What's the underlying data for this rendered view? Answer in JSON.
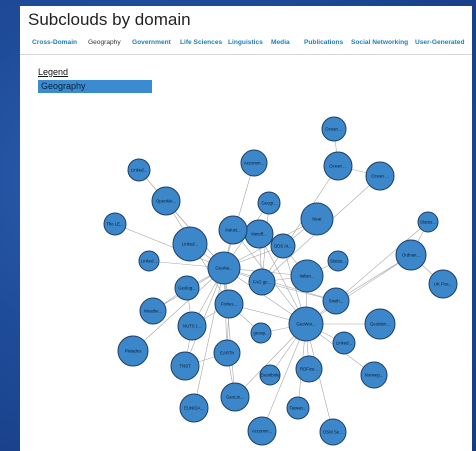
{
  "title": "Subclouds by domain",
  "tabs": [
    {
      "label": "Cross-Domain"
    },
    {
      "label": "Geography",
      "active": true
    },
    {
      "label": "Government"
    },
    {
      "label": "Life Sciences"
    },
    {
      "label": "Linguistics"
    },
    {
      "label": "Media"
    },
    {
      "label": "Publications"
    },
    {
      "label": "Social Networking"
    },
    {
      "label": "User-Generated"
    }
  ],
  "legend": {
    "title": "Legend",
    "items": [
      {
        "label": "Geography",
        "color": "#3b8bd0"
      }
    ]
  },
  "graph": {
    "node_color": "#3c87c9",
    "nodes": [
      {
        "id": "n01",
        "label": "Ocean ..."
      },
      {
        "id": "n02",
        "label": "Accomm..."
      },
      {
        "id": "n03",
        "label": "Ocean ..."
      },
      {
        "id": "n04",
        "label": "Linked..."
      },
      {
        "id": "n05",
        "label": "Ocean ..."
      },
      {
        "id": "n06",
        "label": "OpenMo..."
      },
      {
        "id": "n07",
        "label": "Geogr..."
      },
      {
        "id": "n08",
        "label": "Near"
      },
      {
        "id": "n09",
        "label": "Metoff..."
      },
      {
        "id": "n10",
        "label": "The LE..."
      },
      {
        "id": "n11",
        "label": "Linked..."
      },
      {
        "id": "n12",
        "label": "Indust..."
      },
      {
        "id": "n13",
        "label": "DDS At..."
      },
      {
        "id": "n14",
        "label": "Ordnan..."
      },
      {
        "id": "n15",
        "label": "Linked..."
      },
      {
        "id": "n16",
        "label": "GeoNa..."
      },
      {
        "id": "n17",
        "label": "Status..."
      },
      {
        "id": "n18",
        "label": "UK Pos..."
      },
      {
        "id": "n19",
        "label": "Geolog..."
      },
      {
        "id": "n20",
        "label": "FAO ge..."
      },
      {
        "id": "n21",
        "label": "Italian..."
      },
      {
        "id": "n22",
        "label": "Status..."
      },
      {
        "id": "n23",
        "label": "Fishes..."
      },
      {
        "id": "n24",
        "label": "Weathe..."
      },
      {
        "id": "n25",
        "label": "Smith..."
      },
      {
        "id": "n26",
        "label": "NUTS (..."
      },
      {
        "id": "n27",
        "label": "GeoWor..."
      },
      {
        "id": "n28",
        "label": "GeoMon..."
      },
      {
        "id": "n29",
        "label": "geosp..."
      },
      {
        "id": "n30",
        "label": "Linked..."
      },
      {
        "id": "n31",
        "label": "Pleiades"
      },
      {
        "id": "n32",
        "label": "EARTh"
      },
      {
        "id": "n33",
        "label": "TNST"
      },
      {
        "id": "n34",
        "label": "Eventbrite"
      },
      {
        "id": "n35",
        "label": "RDFize..."
      },
      {
        "id": "n36",
        "label": "Norweg..."
      },
      {
        "id": "n37",
        "label": "GeoLin..."
      },
      {
        "id": "n38",
        "label": "EUNIDA..."
      },
      {
        "id": "n39",
        "label": "Taiwan..."
      },
      {
        "id": "n40",
        "label": "Accomm..."
      },
      {
        "id": "n41",
        "label": "OSM Se..."
      }
    ],
    "edges": [
      [
        "n01",
        "n03"
      ],
      [
        "n03",
        "n05"
      ],
      [
        "n03",
        "n20"
      ],
      [
        "n02",
        "n16"
      ],
      [
        "n04",
        "n16"
      ],
      [
        "n06",
        "n16"
      ],
      [
        "n06",
        "n23"
      ],
      [
        "n10",
        "n16"
      ],
      [
        "n11",
        "n16"
      ],
      [
        "n12",
        "n16"
      ],
      [
        "n07",
        "n16"
      ],
      [
        "n07",
        "n20"
      ],
      [
        "n13",
        "n16"
      ],
      [
        "n08",
        "n16"
      ],
      [
        "n08",
        "n13"
      ],
      [
        "n15",
        "n16"
      ],
      [
        "n19",
        "n16"
      ],
      [
        "n24",
        "n16"
      ],
      [
        "n26",
        "n16"
      ],
      [
        "n31",
        "n16"
      ],
      [
        "n33",
        "n16"
      ],
      [
        "n38",
        "n16"
      ],
      [
        "n32",
        "n16"
      ],
      [
        "n23",
        "n16"
      ],
      [
        "n20",
        "n16"
      ],
      [
        "n21",
        "n16"
      ],
      [
        "n27",
        "n16"
      ],
      [
        "n37",
        "n16"
      ],
      [
        "n05",
        "n20"
      ],
      [
        "n13",
        "n21"
      ],
      [
        "n20",
        "n21"
      ],
      [
        "n22",
        "n21"
      ],
      [
        "n21",
        "n27"
      ],
      [
        "n14",
        "n27"
      ],
      [
        "n14",
        "n17"
      ],
      [
        "n14",
        "n25"
      ],
      [
        "n14",
        "n18"
      ],
      [
        "n17",
        "n25"
      ],
      [
        "n25",
        "n27"
      ],
      [
        "n25",
        "n20"
      ],
      [
        "n25",
        "n16"
      ],
      [
        "n27",
        "n28"
      ],
      [
        "n27",
        "n30"
      ],
      [
        "n27",
        "n36"
      ],
      [
        "n27",
        "n35"
      ],
      [
        "n27",
        "n34"
      ],
      [
        "n27",
        "n39"
      ],
      [
        "n27",
        "n41"
      ],
      [
        "n27",
        "n40"
      ],
      [
        "n27",
        "n37"
      ],
      [
        "n27",
        "n29"
      ],
      [
        "n27",
        "n23"
      ],
      [
        "n27",
        "n13"
      ],
      [
        "n27",
        "n12"
      ],
      [
        "n27",
        "n09"
      ],
      [
        "n23",
        "n29"
      ],
      [
        "n23",
        "n26"
      ],
      [
        "n23",
        "n32"
      ],
      [
        "n26",
        "n19"
      ],
      [
        "n26",
        "n33"
      ],
      [
        "n32",
        "n33"
      ],
      [
        "n32",
        "n37"
      ],
      [
        "n12",
        "n09"
      ],
      [
        "n09",
        "n20"
      ],
      [
        "n19",
        "n24"
      ]
    ]
  }
}
